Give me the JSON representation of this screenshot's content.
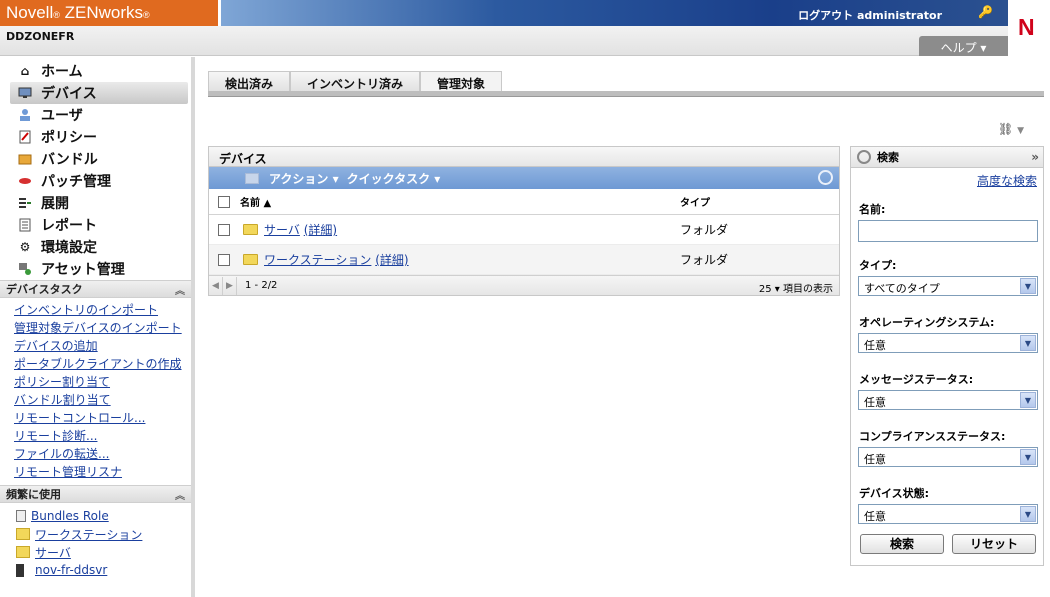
{
  "header": {
    "brand": "Novell",
    "brand_reg": "®",
    "product": "ZENworks",
    "product_reg": "®",
    "logout": "ログアウト administrator",
    "zone": "DDZONEFR",
    "help": "ヘルプ ▾",
    "logo": "N"
  },
  "nav": {
    "items": [
      {
        "label": "ホーム"
      },
      {
        "label": "デバイス"
      },
      {
        "label": "ユーザ"
      },
      {
        "label": "ポリシー"
      },
      {
        "label": "バンドル"
      },
      {
        "label": "パッチ管理"
      },
      {
        "label": "展開"
      },
      {
        "label": "レポート"
      },
      {
        "label": "環境設定"
      },
      {
        "label": "アセット管理"
      }
    ]
  },
  "device_tasks": {
    "title": "デバイスタスク",
    "items": [
      "インベントリのインポート",
      "管理対象デバイスのインポート",
      "デバイスの追加",
      "ポータブルクライアントの作成",
      "ポリシー割り当て",
      "バンドル割り当て",
      "リモートコントロール...",
      "リモート診断...",
      "ファイルの転送...",
      "リモート管理リスナ"
    ]
  },
  "frequent": {
    "title": "頻繁に使用",
    "items": [
      "Bundles Role",
      "ワークステーション",
      "サーバ",
      "nov-fr-ddsvr"
    ]
  },
  "tabs": [
    "検出済み",
    "インベントリ済み",
    "管理対象"
  ],
  "devices": {
    "title": "デバイス",
    "actions": "アクション ▾",
    "quick_tasks": "クイックタスク ▾",
    "columns": {
      "name": "名前 ▲",
      "type": "タイプ"
    },
    "rows": [
      {
        "name": "サーバ",
        "details": "(詳細)",
        "type": "フォルダ"
      },
      {
        "name": "ワークステーション",
        "details": "(詳細)",
        "type": "フォルダ"
      }
    ],
    "range": "1 - 2/2",
    "per_page": "25 ▾ 項目の表示"
  },
  "search": {
    "title": "検索",
    "advanced": "高度な検索",
    "name_label": "名前:",
    "name_value": "",
    "type_label": "タイプ:",
    "type_value": "すべてのタイプ",
    "os_label": "オペレーティングシステム:",
    "os_value": "任意",
    "msg_label": "メッセージステータス:",
    "msg_value": "任意",
    "compliance_label": "コンプライアンスステータス:",
    "compliance_value": "任意",
    "state_label": "デバイス状態:",
    "state_value": "任意",
    "search_button": "検索",
    "reset_button": "リセット"
  }
}
